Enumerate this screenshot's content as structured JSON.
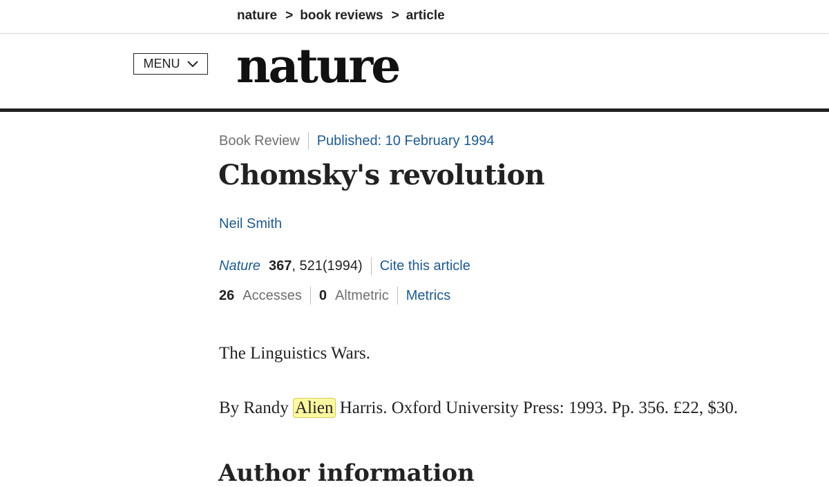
{
  "breadcrumb": {
    "items": [
      "nature",
      "book reviews",
      "article"
    ],
    "separator": ">"
  },
  "header": {
    "menu_label": "MENU",
    "logo": "nature"
  },
  "article": {
    "type": "Book Review",
    "published": "Published: 10 February 1994",
    "title": "Chomsky's revolution",
    "author": "Neil Smith",
    "journal": "Nature",
    "volume": "367",
    "pages_year": ", 521(1994)",
    "cite_label": "Cite this article",
    "accesses_count": "26",
    "accesses_label": "Accesses",
    "altmetric_count": "0",
    "altmetric_label": "Altmetric",
    "metrics_label": "Metrics"
  },
  "body": {
    "book_title": "The Linguistics Wars.",
    "byline_prefix": "By Randy",
    "byline_highlight": "Alien",
    "byline_suffix": "Harris. Oxford University Press: 1993. Pp. 356. £22, $30."
  },
  "section": {
    "heading": "Author information"
  },
  "colors": {
    "link": "#1f5a8e",
    "highlight": "#fdf9a0",
    "rule": "#222222"
  }
}
